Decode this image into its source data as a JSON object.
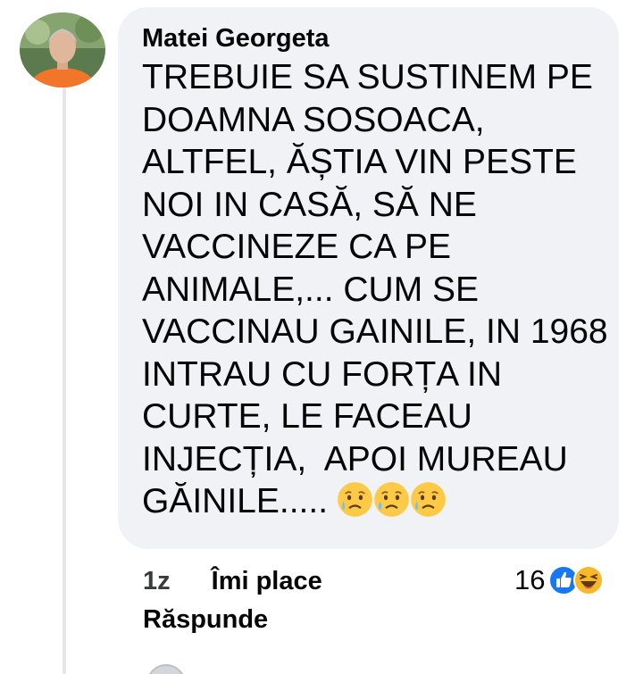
{
  "comment": {
    "author": "Matei Georgeta",
    "text": "TREBUIE SA SUSTINEM PE\nDOAMNA SOSOACA,\nALTFEL, ĂȘTIA VIN PESTE\nNOI IN CASĂ, SĂ NE\nVACCINEZE CA PE\nANIMALE,... CUM SE\nVACCINAU GAINILE, IN 1968\nINTRAU CU FORȚA IN\nCURTE, LE FACEAU\nINJECȚIA,  APOI MUREAU\nGĂINILE..... ",
    "emojis": [
      "sad-tear-face",
      "sad-tear-face",
      "sad-tear-face"
    ],
    "time": "1z",
    "like_label": "Îmi place",
    "reply_label": "Răspunde",
    "reaction_count": "16",
    "reactions": [
      "like",
      "haha"
    ]
  },
  "colors": {
    "bubble": "#f0f2f5",
    "like_blue": "#1877f2",
    "haha_yellow": "#f7b928",
    "text": "#050505"
  }
}
